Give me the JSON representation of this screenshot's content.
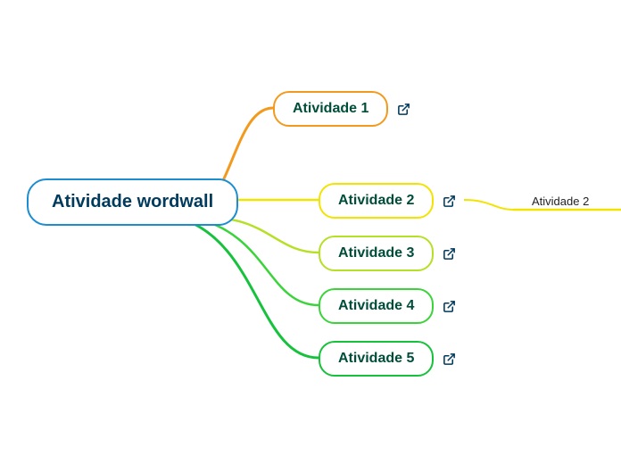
{
  "root": {
    "label": "Atividade wordwall"
  },
  "children": [
    {
      "label": "Atividade 1",
      "color": "#f39a1e",
      "has_link": true
    },
    {
      "label": "Atividade 2",
      "color": "#f3e300",
      "has_link": true
    },
    {
      "label": "Atividade 3",
      "color": "#b6e026",
      "has_link": true
    },
    {
      "label": "Atividade 4",
      "color": "#3ad43a",
      "has_link": true
    },
    {
      "label": "Atividade 5",
      "color": "#16c23c",
      "has_link": true
    }
  ],
  "leaf": {
    "label": "Atividade 2",
    "color": "#f3e300"
  },
  "colors": {
    "root_border": "#1b8dd0",
    "root_text": "#003a5d",
    "child_text": "#004d3a",
    "link_icon": "#003a5d"
  }
}
